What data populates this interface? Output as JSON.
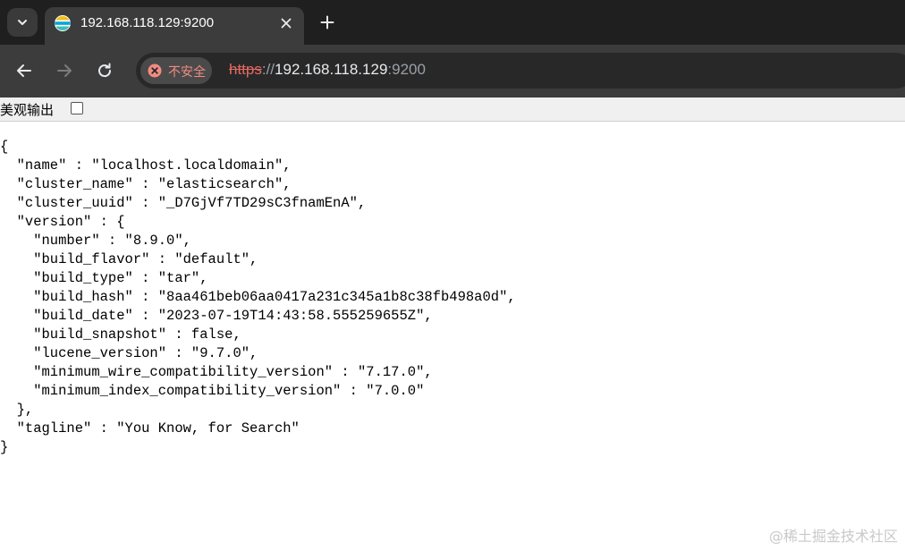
{
  "browser": {
    "tab": {
      "title": "192.168.118.129:9200"
    },
    "omnibox": {
      "security_label": "不安全",
      "url_scheme": "https",
      "url_separator": "://",
      "url_host": "192.168.118.129",
      "url_port": ":9200"
    },
    "colors": {
      "tabstrip": "#1f1f1f",
      "toolbar": "#3c3c3c",
      "insecure": "#e46962"
    }
  },
  "prettyprint": {
    "label": "美观输出",
    "checked": false
  },
  "json_lines": [
    "{",
    "  \"name\" : \"localhost.localdomain\",",
    "  \"cluster_name\" : \"elasticsearch\",",
    "  \"cluster_uuid\" : \"_D7GjVf7TD29sC3fnamEnA\",",
    "  \"version\" : {",
    "    \"number\" : \"8.9.0\",",
    "    \"build_flavor\" : \"default\",",
    "    \"build_type\" : \"tar\",",
    "    \"build_hash\" : \"8aa461beb06aa0417a231c345a1b8c38fb498a0d\",",
    "    \"build_date\" : \"2023-07-19T14:43:58.555259655Z\",",
    "    \"build_snapshot\" : false,",
    "    \"lucene_version\" : \"9.7.0\",",
    "    \"minimum_wire_compatibility_version\" : \"7.17.0\",",
    "    \"minimum_index_compatibility_version\" : \"7.0.0\"",
    "  },",
    "  \"tagline\" : \"You Know, for Search\"",
    "}"
  ],
  "watermark": "@稀土掘金技术社区"
}
